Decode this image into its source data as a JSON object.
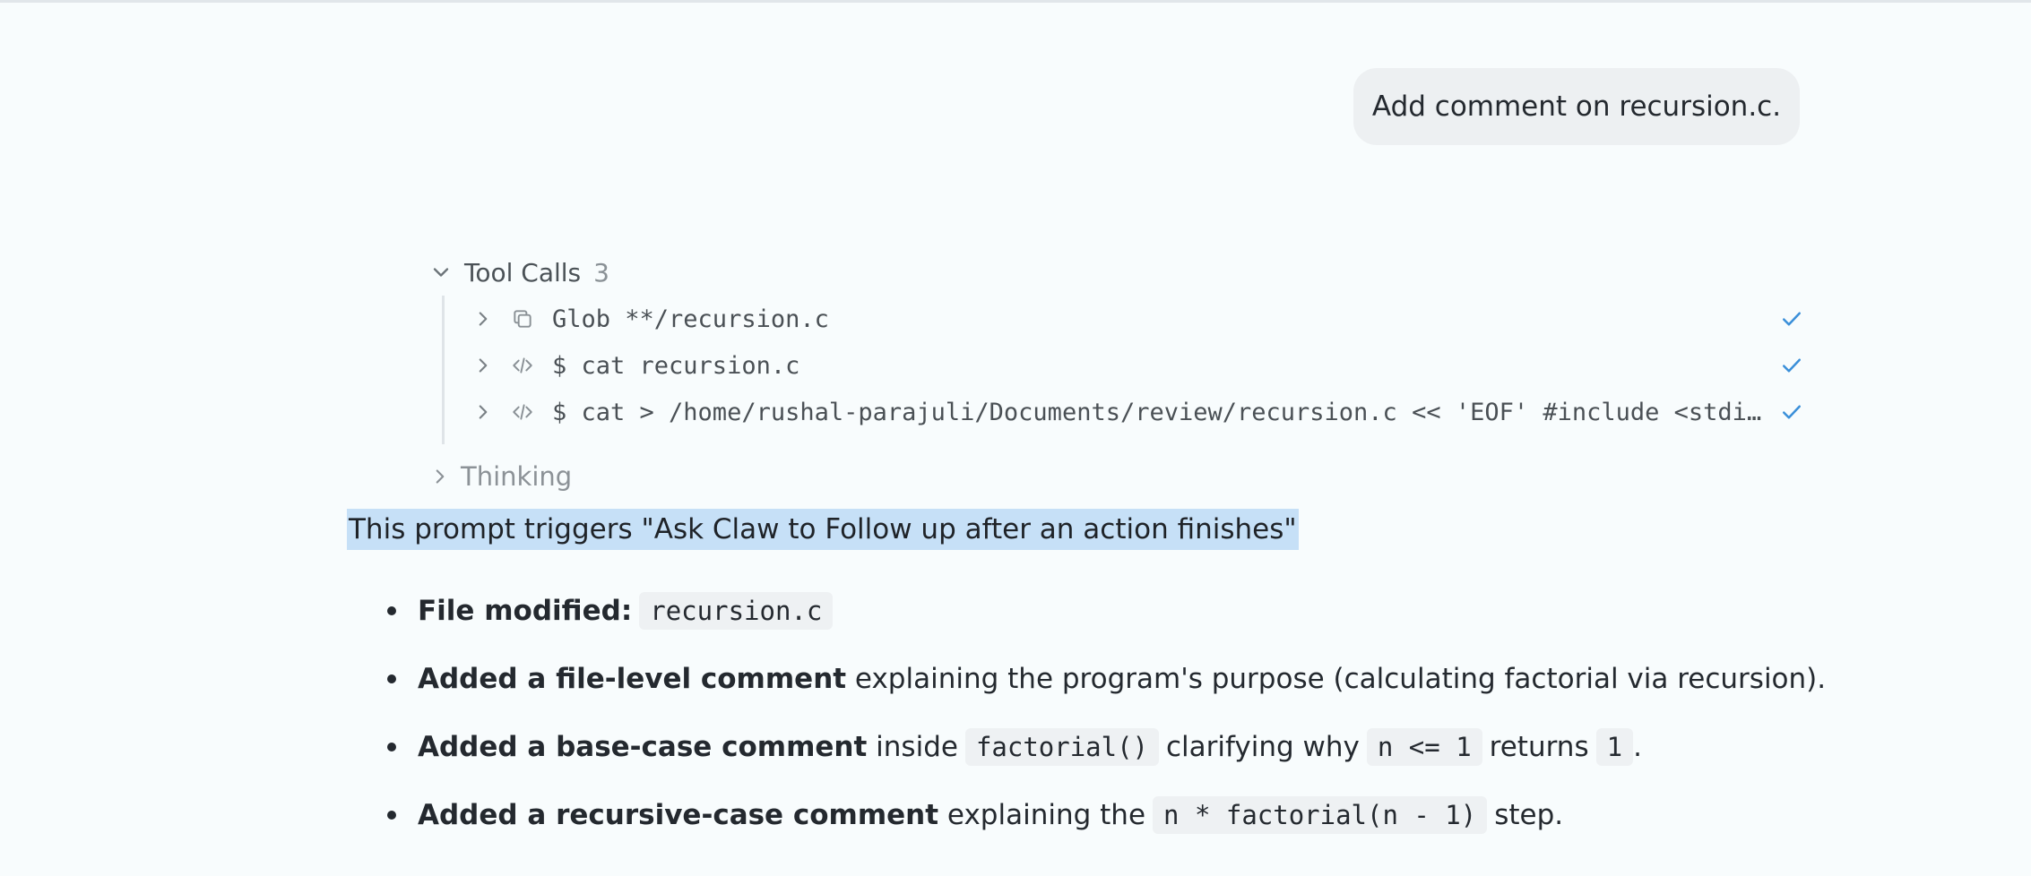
{
  "user_message": "Add comment on recursion.c.",
  "tool_calls": {
    "label": "Tool Calls",
    "count": "3",
    "items": [
      {
        "icon": "copy-icon",
        "command": "Glob **/recursion.c",
        "status": "done"
      },
      {
        "icon": "code-icon",
        "command": "$ cat recursion.c",
        "status": "done"
      },
      {
        "icon": "code-icon",
        "command": "$ cat > /home/rushal-parajuli/Documents/review/recursion.c << 'EOF' #include <stdi…",
        "status": "done"
      }
    ]
  },
  "thinking": {
    "label": "Thinking"
  },
  "response": {
    "highlighted_line": "This prompt triggers \"Ask Claw to Follow up after an action finishes\"",
    "bullets": [
      {
        "bold": "File modified:",
        "code1": "recursion.c"
      },
      {
        "bold": "Added a file-level comment",
        "text1": " explaining the program's purpose (calculating factorial via recursion)."
      },
      {
        "bold": "Added a base-case comment",
        "text1": " inside",
        "code1": "factorial()",
        "text2": "clarifying why",
        "code2": "n <= 1",
        "text3": "returns",
        "code3": "1",
        "text4": "."
      },
      {
        "bold": "Added a recursive-case comment",
        "text1": " explaining the",
        "code1": "n * factorial(n - 1)",
        "text2": "step."
      }
    ]
  },
  "colors": {
    "accent": "#3a8fd9",
    "highlight": "#c6e0f7",
    "background": "#f8fcfd"
  }
}
